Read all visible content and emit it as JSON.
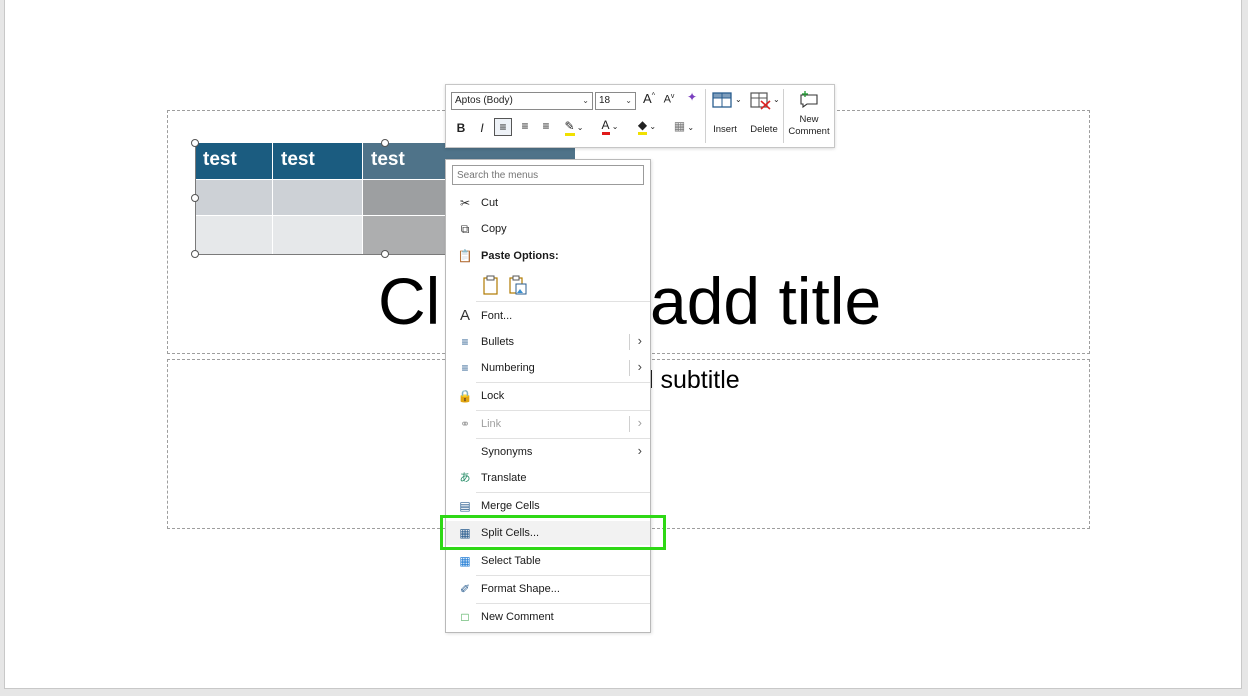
{
  "slide": {
    "title_placeholder": "Click to add title",
    "title_visible_left": "Cl",
    "title_visible_right": "add title",
    "subtitle_visible": "l subtitle"
  },
  "table": {
    "headers": [
      "test",
      "test",
      "test"
    ]
  },
  "mini_toolbar": {
    "font_name": "Aptos (Body)",
    "font_size": "18",
    "grow_font": "A",
    "shrink_font": "A",
    "bold": "B",
    "italic": "I",
    "insert_label": "Insert",
    "delete_label": "Delete",
    "new_comment_label_1": "New",
    "new_comment_label_2": "Comment"
  },
  "context_menu": {
    "search_placeholder": "Search the menus",
    "items": [
      {
        "label": "Cut",
        "icon": "scissors-icon"
      },
      {
        "label": "Copy",
        "icon": "copy-icon"
      },
      {
        "label": "Paste Options:",
        "icon": "paste-icon"
      },
      {
        "label": "Font...",
        "icon": "font-icon"
      },
      {
        "label": "Bullets",
        "icon": "bullets-icon"
      },
      {
        "label": "Numbering",
        "icon": "numbering-icon"
      },
      {
        "label": "Lock",
        "icon": "lock-icon"
      },
      {
        "label": "Link",
        "icon": "link-icon",
        "disabled": true
      },
      {
        "label": "Synonyms",
        "icon": ""
      },
      {
        "label": "Translate",
        "icon": "translate-icon"
      },
      {
        "label": "Merge Cells",
        "icon": "merge-cells-icon"
      },
      {
        "label": "Split Cells...",
        "icon": "split-cells-icon"
      },
      {
        "label": "Select Table",
        "icon": "select-table-icon"
      },
      {
        "label": "Format Shape...",
        "icon": "format-shape-icon"
      },
      {
        "label": "New Comment",
        "icon": "new-comment-icon"
      }
    ]
  },
  "colors": {
    "table_header": "#1b5c80",
    "highlight": "#2ed815"
  }
}
